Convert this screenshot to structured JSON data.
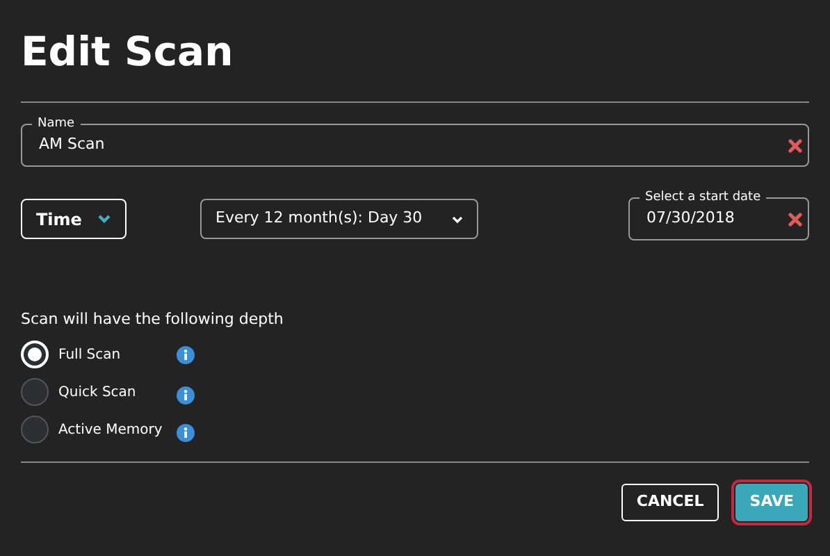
{
  "title": "Edit Scan",
  "name_field": {
    "label": "Name",
    "value": "AM Scan"
  },
  "schedule": {
    "unit": "Time",
    "frequency": "Every 12 month(s): Day 30"
  },
  "start_date": {
    "label": "Select a start date",
    "value": "07/30/2018"
  },
  "depth_prompt": "Scan will have the following depth",
  "depth_options": [
    {
      "label": "Full Scan",
      "selected": true
    },
    {
      "label": "Quick Scan",
      "selected": false
    },
    {
      "label": "Active Memory",
      "selected": false
    }
  ],
  "buttons": [
    {
      "label": "CANCEL",
      "kind": "secondary",
      "focused": false
    },
    {
      "label": "SAVE",
      "kind": "primary",
      "focused": true
    }
  ]
}
